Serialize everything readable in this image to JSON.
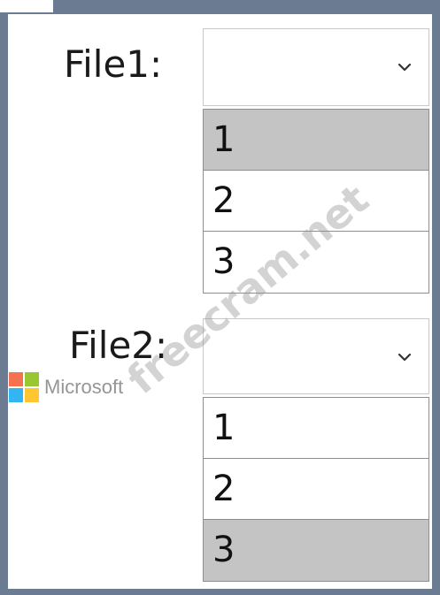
{
  "fields": [
    {
      "label": "File1:",
      "selected_value": "",
      "options": [
        "1",
        "2",
        "3"
      ],
      "highlighted_option": "1"
    },
    {
      "label": "File2:",
      "selected_value": "",
      "options": [
        "1",
        "2",
        "3"
      ],
      "highlighted_option": "3"
    }
  ],
  "icons": {
    "dropdown_arrow": "chevron-down-icon"
  },
  "logo": {
    "text": "Microsoft"
  },
  "watermark": {
    "text": "freecram.net"
  },
  "colors": {
    "border": "#6b7c92",
    "highlight": "#c4c4c4"
  }
}
